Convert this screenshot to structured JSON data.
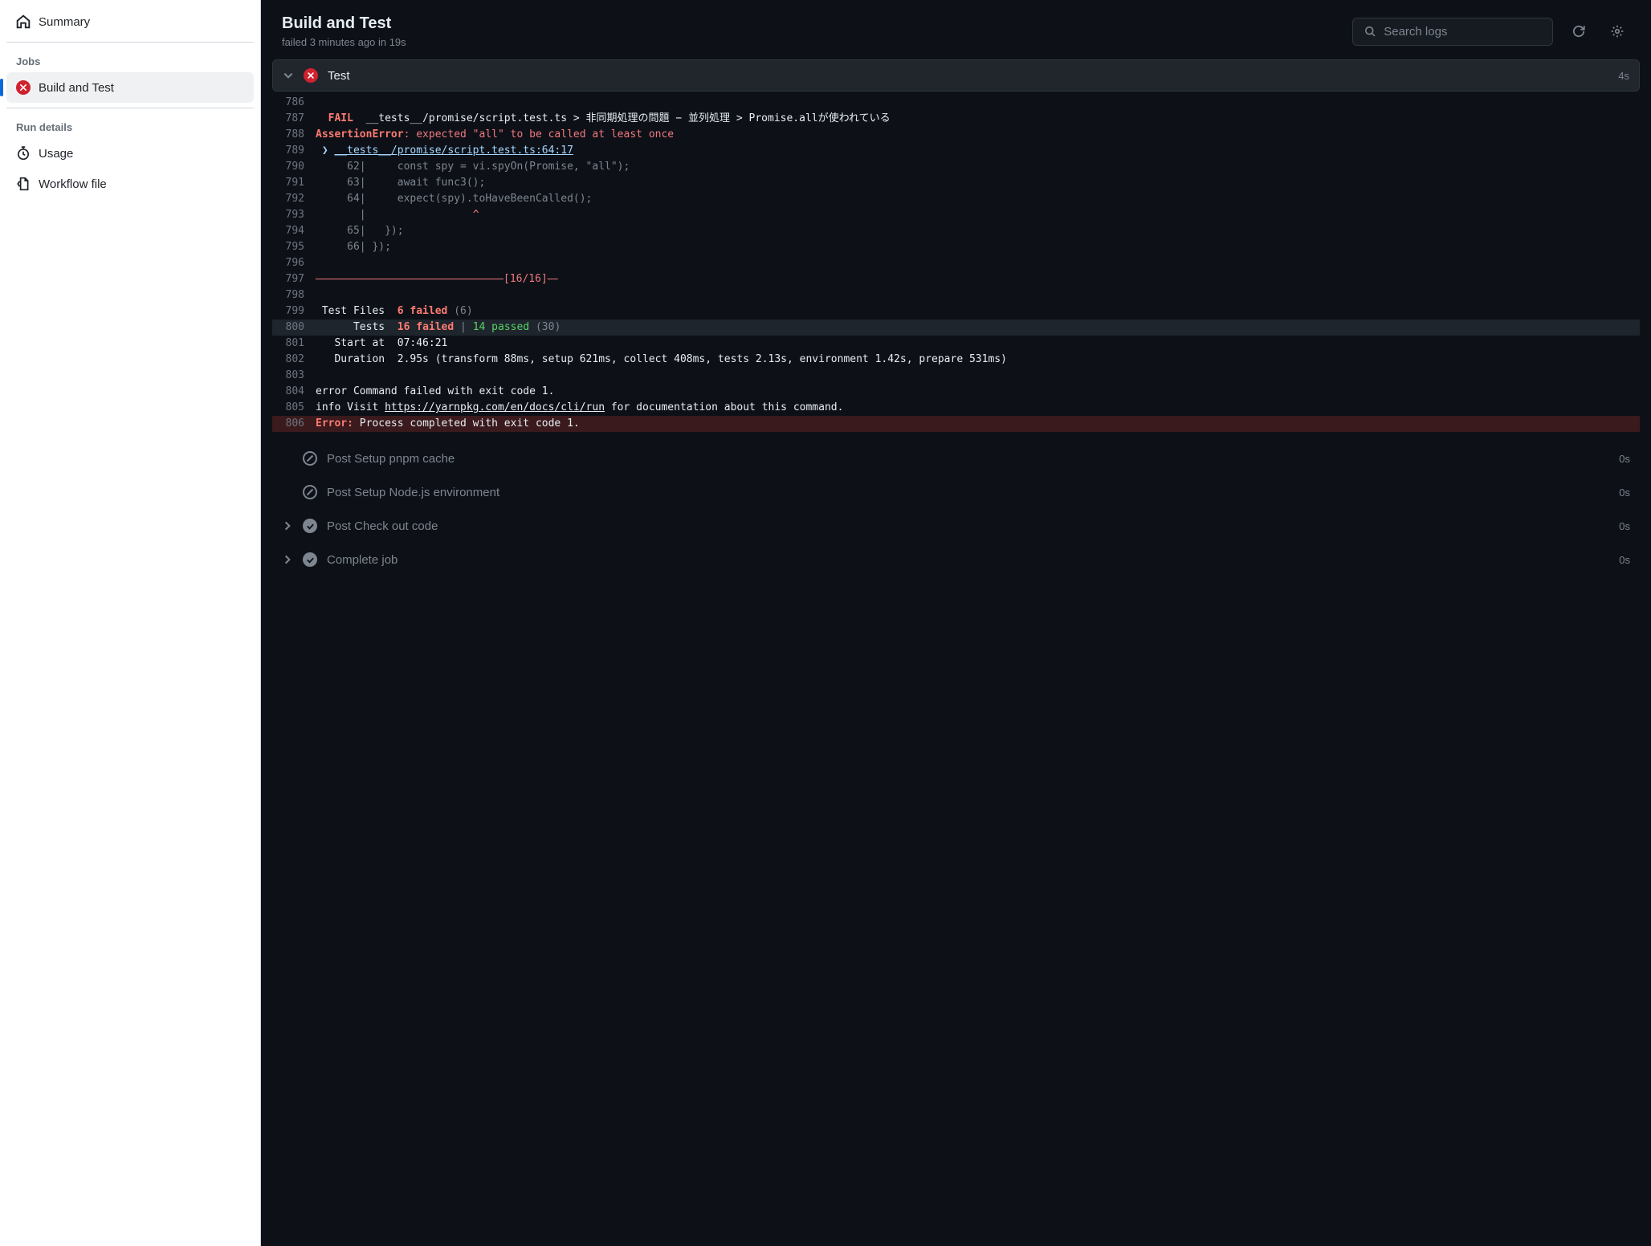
{
  "sidebar": {
    "summary_label": "Summary",
    "jobs_heading": "Jobs",
    "job_item_label": "Build and Test",
    "run_details_heading": "Run details",
    "usage_label": "Usage",
    "workflow_file_label": "Workflow file"
  },
  "header": {
    "title": "Build and Test",
    "subtitle": "failed 3 minutes ago in 19s",
    "search_placeholder": "Search logs"
  },
  "expanded_step": {
    "title": "Test",
    "duration": "4s",
    "lines": [
      {
        "n": "786",
        "segments": []
      },
      {
        "n": "787",
        "segments": [
          {
            "t": " ",
            "c": ""
          },
          {
            "t": " FAIL ",
            "c": "c-red-bold"
          },
          {
            "t": " __tests__/promise/script.test.ts > 非同期処理の問題 − 並列処理 > Promise.allが使われている",
            "c": "c-white"
          }
        ]
      },
      {
        "n": "788",
        "segments": [
          {
            "t": "AssertionError",
            "c": "c-red-bold"
          },
          {
            "t": ": expected \"all\" to be called at least once",
            "c": "c-salmon"
          }
        ]
      },
      {
        "n": "789",
        "segments": [
          {
            "t": " ❯ ",
            "c": "c-cyan"
          },
          {
            "t": "__tests__/promise/script.test.ts:64:17",
            "c": "c-cyan-underline"
          }
        ]
      },
      {
        "n": "790",
        "segments": [
          {
            "t": "     62|     const spy = vi.spyOn(Promise, \"all\");",
            "c": "c-dim"
          }
        ]
      },
      {
        "n": "791",
        "segments": [
          {
            "t": "     63|     await func3();",
            "c": "c-dim"
          }
        ]
      },
      {
        "n": "792",
        "segments": [
          {
            "t": "     64|     expect(spy).toHaveBeenCalled();",
            "c": "c-dim"
          }
        ]
      },
      {
        "n": "793",
        "segments": [
          {
            "t": "       |                 ",
            "c": "c-dim"
          },
          {
            "t": "^",
            "c": "c-red"
          }
        ]
      },
      {
        "n": "794",
        "segments": [
          {
            "t": "     65|   });",
            "c": "c-dim"
          }
        ]
      },
      {
        "n": "795",
        "segments": [
          {
            "t": "     66| });",
            "c": "c-dim"
          }
        ]
      },
      {
        "n": "796",
        "segments": []
      },
      {
        "n": "797",
        "segments": [
          {
            "t": "⎯⎯⎯⎯⎯⎯⎯⎯⎯⎯⎯⎯⎯⎯⎯⎯⎯⎯⎯⎯⎯⎯⎯⎯⎯⎯⎯⎯⎯⎯⎯⎯⎯⎯⎯⎯[16/16]⎯⎯",
            "c": "c-salmon"
          }
        ]
      },
      {
        "n": "798",
        "segments": []
      },
      {
        "n": "799",
        "segments": [
          {
            "t": " Test Files  ",
            "c": "c-white"
          },
          {
            "t": "6 failed",
            "c": "c-red-bold"
          },
          {
            "t": " (6)",
            "c": "c-dim"
          }
        ]
      },
      {
        "n": "800",
        "highlight": true,
        "segments": [
          {
            "t": "      Tests  ",
            "c": "c-white"
          },
          {
            "t": "16 failed",
            "c": "c-red-bold"
          },
          {
            "t": " | ",
            "c": "c-dim"
          },
          {
            "t": "14 passed",
            "c": "c-green"
          },
          {
            "t": " (30)",
            "c": "c-dim"
          }
        ]
      },
      {
        "n": "801",
        "segments": [
          {
            "t": "   Start at  07:46:21",
            "c": "c-white"
          }
        ]
      },
      {
        "n": "802",
        "segments": [
          {
            "t": "   Duration  2.95s (transform 88ms, setup 621ms, collect 408ms, tests 2.13s, environment 1.42s, prepare 531ms)",
            "c": "c-white"
          }
        ]
      },
      {
        "n": "803",
        "segments": []
      },
      {
        "n": "804",
        "segments": [
          {
            "t": "error Command failed with exit code 1.",
            "c": "c-white"
          }
        ]
      },
      {
        "n": "805",
        "segments": [
          {
            "t": "info Visit ",
            "c": "c-white"
          },
          {
            "t": "https://yarnpkg.com/en/docs/cli/run",
            "c": "c-link"
          },
          {
            "t": " for documentation about this command.",
            "c": "c-white"
          }
        ]
      },
      {
        "n": "806",
        "error": true,
        "segments": [
          {
            "t": "Error: ",
            "c": "c-red-bold"
          },
          {
            "t": "Process completed with exit code 1.",
            "c": "c-white"
          }
        ]
      }
    ]
  },
  "collapsed_steps": [
    {
      "title": "Post Setup pnpm cache",
      "duration": "0s",
      "status": "skipped",
      "chevron": false
    },
    {
      "title": "Post Setup Node.js environment",
      "duration": "0s",
      "status": "skipped",
      "chevron": false
    },
    {
      "title": "Post Check out code",
      "duration": "0s",
      "status": "success",
      "chevron": true
    },
    {
      "title": "Complete job",
      "duration": "0s",
      "status": "success",
      "chevron": true
    }
  ]
}
